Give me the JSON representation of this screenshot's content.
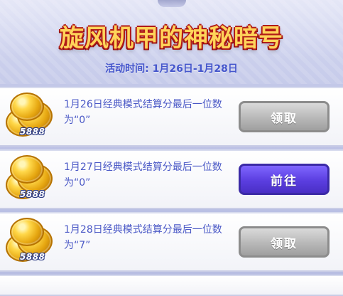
{
  "header": {
    "title": "旋风机甲的神秘暗号",
    "subtitle": "活动时间: 1月26日-1月28日"
  },
  "tasks": [
    {
      "reward": "5888",
      "text": "1月26日经典模式结算分最后一位数为“0”",
      "button": {
        "label": "领取",
        "style": "gray"
      }
    },
    {
      "reward": "5888",
      "text": "1月27日经典模式结算分最后一位数为“0”",
      "button": {
        "label": "前往",
        "style": "purple"
      }
    },
    {
      "reward": "5888",
      "text": "1月28日经典模式结算分最后一位数为“7”",
      "button": {
        "label": "领取",
        "style": "gray"
      }
    }
  ],
  "colors": {
    "title_gold": "#ffd45a",
    "title_outline": "#b11b18",
    "subtitle_blue": "#4556cc",
    "task_text_blue": "#4a58c6",
    "button_gray": "#b8b8b8",
    "button_purple": "#5b3ee0"
  },
  "icons": {
    "reward_icon": "coin-stack-icon"
  }
}
